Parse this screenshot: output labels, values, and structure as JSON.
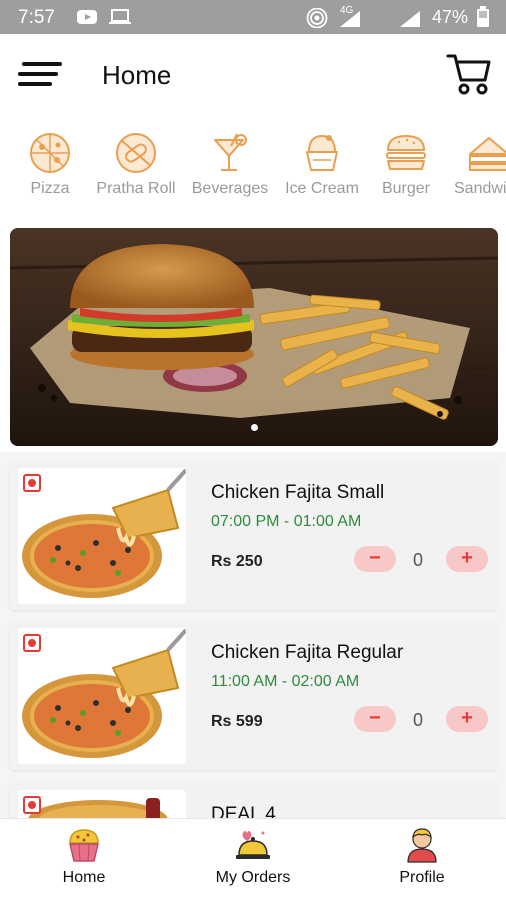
{
  "status_bar": {
    "time": "7:57",
    "signal_label": "4G",
    "battery": "47%"
  },
  "header": {
    "title": "Home",
    "menu_icon": "hamburger-menu-icon",
    "cart_icon": "shopping-cart-icon"
  },
  "categories": [
    {
      "label": "Pizza",
      "icon": "pizza-icon"
    },
    {
      "label": "Pratha Roll",
      "icon": "pratha-roll-icon"
    },
    {
      "label": "Beverages",
      "icon": "beverages-icon"
    },
    {
      "label": "Ice Cream",
      "icon": "ice-cream-icon"
    },
    {
      "label": "Burger",
      "icon": "burger-icon"
    },
    {
      "label": "Sandwi",
      "icon": "sandwich-icon"
    }
  ],
  "banner": {
    "slide_count": 2,
    "active_slide": 1
  },
  "items": [
    {
      "name": "Chicken Fajita Small",
      "time": "07:00 PM - 01:00 AM",
      "price": "Rs 250",
      "qty": "0",
      "minus": "−",
      "plus": "+"
    },
    {
      "name": "Chicken Fajita Regular",
      "time": "11:00 AM - 02:00 AM",
      "price": "Rs 599",
      "qty": "0",
      "minus": "−",
      "plus": "+"
    },
    {
      "name": "DEAL 4"
    }
  ],
  "bottom_nav": [
    {
      "label": "Home",
      "icon": "cupcake-icon"
    },
    {
      "label": "My Orders",
      "icon": "food-tray-icon"
    },
    {
      "label": "Profile",
      "icon": "user-avatar-icon"
    }
  ],
  "colors": {
    "accent_green": "#2e8b3d",
    "stepper_bg": "#f8c7c7",
    "stepper_text": "#e53935",
    "category_icon": "#e8a050",
    "status_bar": "#9e9e9e"
  }
}
